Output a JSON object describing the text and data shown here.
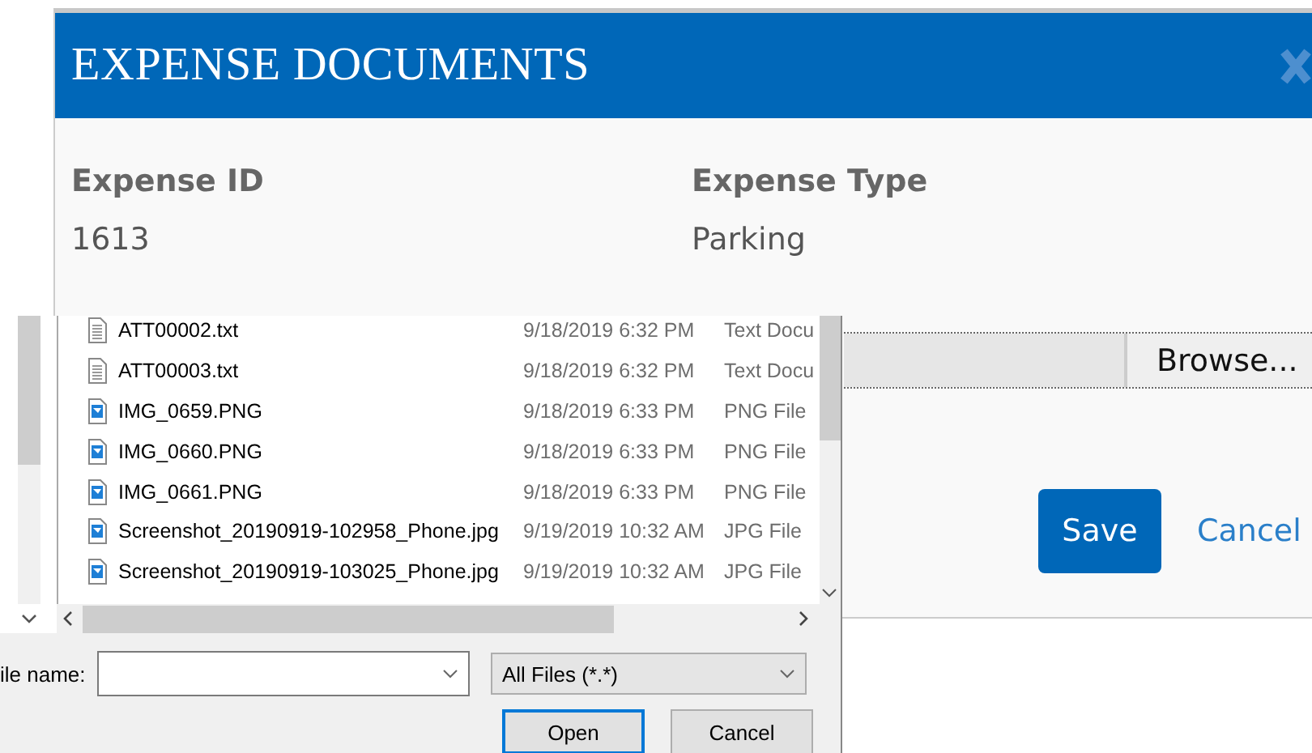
{
  "modal": {
    "title": "EXPENSE DOCUMENTS",
    "fields": [
      {
        "label": "Expense ID",
        "value": "1613"
      },
      {
        "label": "Expense Type",
        "value": "Parking"
      }
    ],
    "browse_button": "Browse...",
    "buttons": [
      {
        "label": "Save",
        "kind": "primary"
      },
      {
        "label": "Cancel",
        "kind": "link"
      }
    ]
  },
  "file_dialog": {
    "files": [
      {
        "name": "ATT00002.txt",
        "date": "9/18/2019 6:32 PM",
        "type": "Text Docu",
        "kind": "text"
      },
      {
        "name": "ATT00003.txt",
        "date": "9/18/2019 6:32 PM",
        "type": "Text Docu",
        "kind": "text"
      },
      {
        "name": "IMG_0659.PNG",
        "date": "9/18/2019 6:33 PM",
        "type": "PNG File",
        "kind": "image"
      },
      {
        "name": "IMG_0660.PNG",
        "date": "9/18/2019 6:33 PM",
        "type": "PNG File",
        "kind": "image"
      },
      {
        "name": "IMG_0661.PNG",
        "date": "9/18/2019 6:33 PM",
        "type": "PNG File",
        "kind": "image"
      },
      {
        "name": "Screenshot_20190919-102958_Phone.jpg",
        "date": "9/19/2019 10:32 AM",
        "type": "JPG File",
        "kind": "image"
      },
      {
        "name": "Screenshot_20190919-103025_Phone.jpg",
        "date": "9/19/2019 10:32 AM",
        "type": "JPG File",
        "kind": "image"
      }
    ],
    "file_name_label": "ile name:",
    "filter": "All Files (*.*)",
    "buttons": [
      {
        "label": "Open",
        "focused": true
      },
      {
        "label": "Cancel",
        "focused": false
      }
    ]
  }
}
